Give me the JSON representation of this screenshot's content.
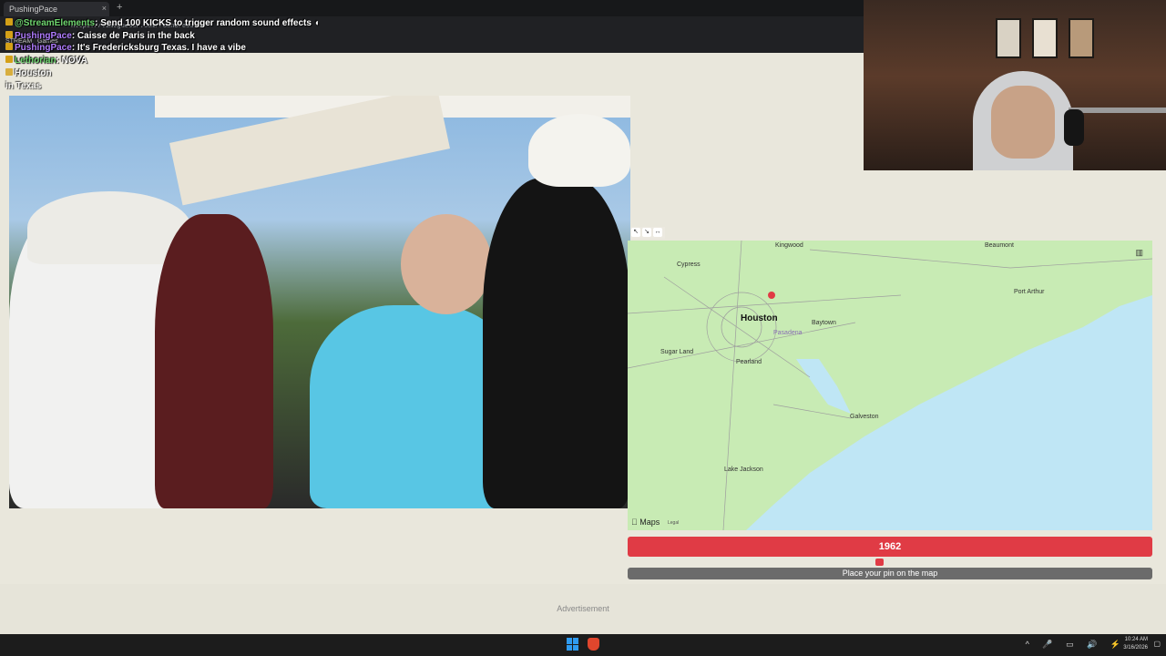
{
  "browser": {
    "tab_title": "PushingPace",
    "new_tab_symbol": "+",
    "close_symbol": "×",
    "url": "https://timeguessr.com/roundresults",
    "bookmarks": [
      "STREAM",
      "Games"
    ]
  },
  "chat": [
    {
      "user": "@StreamElements",
      "message": "Send 100 KICKS to trigger random sound effects ◖"
    },
    {
      "user": "PushingPace",
      "message": "Caisse de Paris in the back"
    },
    {
      "user": "PushingPace",
      "message": "It's Fredericksburg Texas. I have a vibe"
    },
    {
      "user": "Lethorian",
      "message": "NOVA"
    },
    {
      "user": "",
      "message": "Houston"
    },
    {
      "user": "",
      "message": "in Texas"
    }
  ],
  "map": {
    "main_city": "Houston",
    "labels": [
      "Cypress",
      "Kingwood",
      "Beaumont",
      "Port Arthur",
      "Baytown",
      "Pasadena",
      "Sugar Land",
      "Pearland",
      "Galveston",
      "Lake Jackson"
    ],
    "logo": "Maps",
    "legal": "Legal",
    "layers_icon": "map-layers-icon",
    "water_color": "#bfe6f5",
    "land_color": "#c8ebb4"
  },
  "year": {
    "value": "1962",
    "slider_fraction": 0.48
  },
  "action_label": "Place your pin on the map",
  "ad_label": "Advertisement",
  "taskbar": {
    "time": "10:24 AM",
    "date": "3/16/2026"
  }
}
